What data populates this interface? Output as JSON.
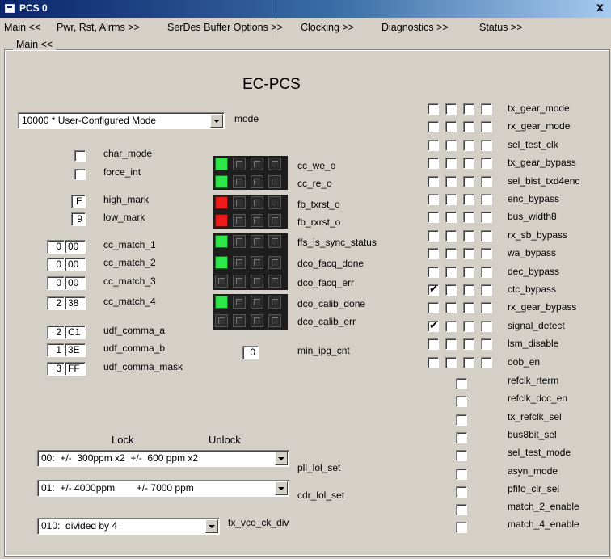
{
  "window": {
    "title": "PCS 0",
    "close_label": "x"
  },
  "menu": [
    "Main <<",
    "Pwr, Rst, Alrms >>",
    "SerDes Buffer Options >>",
    "Clocking >>",
    "Diagnostics >>",
    "Status >>"
  ],
  "group_label": "Main  <<",
  "heading": "EC-PCS",
  "mode": {
    "value": "10000 * User-Configured Mode",
    "label": "mode"
  },
  "char_mode": {
    "label": "char_mode",
    "checked": false
  },
  "force_int": {
    "label": "force_int",
    "checked": false
  },
  "high_mark": {
    "value": "E",
    "label": "high_mark"
  },
  "low_mark": {
    "value": "9",
    "label": "low_mark"
  },
  "cc_match": [
    {
      "a": "0",
      "b": "00",
      "label": "cc_match_1"
    },
    {
      "a": "0",
      "b": "00",
      "label": "cc_match_2"
    },
    {
      "a": "0",
      "b": "00",
      "label": "cc_match_3"
    },
    {
      "a": "2",
      "b": "38",
      "label": "cc_match_4"
    }
  ],
  "udf": [
    {
      "a": "2",
      "b": "C1",
      "label": "udf_comma_a"
    },
    {
      "a": "1",
      "b": "3E",
      "label": "udf_comma_b"
    },
    {
      "a": "3",
      "b": "FF",
      "label": "udf_comma_mask"
    }
  ],
  "status": [
    {
      "label": "cc_we_o",
      "leds": [
        "green",
        "grey",
        "grey",
        "grey"
      ]
    },
    {
      "label": "cc_re_o",
      "leds": [
        "green",
        "grey",
        "grey",
        "grey"
      ]
    },
    {
      "label": "fb_txrst_o",
      "leds": [
        "red",
        "grey",
        "grey",
        "grey"
      ]
    },
    {
      "label": "fb_rxrst_o",
      "leds": [
        "red",
        "grey",
        "grey",
        "grey"
      ]
    },
    {
      "label": "ffs_ls_sync_status",
      "leds": [
        "green",
        "grey",
        "grey",
        "grey"
      ]
    },
    {
      "label": "dco_facq_done",
      "leds": [
        "green",
        "grey",
        "grey",
        "grey"
      ]
    },
    {
      "label": "dco_facq_err",
      "leds": [
        "grey",
        "grey",
        "grey",
        "grey"
      ]
    },
    {
      "label": "dco_calib_done",
      "leds": [
        "green",
        "grey",
        "grey",
        "grey"
      ]
    },
    {
      "label": "dco_calib_err",
      "leds": [
        "grey",
        "grey",
        "grey",
        "grey"
      ]
    }
  ],
  "min_ipg": {
    "value": "0",
    "label": "min_ipg_cnt"
  },
  "lol_headers": {
    "lock": "Lock",
    "unlock": "Unlock"
  },
  "pll_lol": {
    "value": "00:  +/-  300ppm x2  +/-  600 ppm x2",
    "label": "pll_lol_set"
  },
  "cdr_lol": {
    "value": "01:  +/- 4000ppm        +/- 7000 ppm",
    "label": "cdr_lol_set"
  },
  "tx_vco": {
    "value": "010:  divided by 4",
    "label": "tx_vco_ck_div"
  },
  "right_quad": [
    {
      "label": "tx_gear_mode",
      "checks": [
        false,
        false,
        false,
        false
      ]
    },
    {
      "label": "rx_gear_mode",
      "checks": [
        false,
        false,
        false,
        false
      ]
    },
    {
      "label": "sel_test_clk",
      "checks": [
        false,
        false,
        false,
        false
      ]
    },
    {
      "label": "tx_gear_bypass",
      "checks": [
        false,
        false,
        false,
        false
      ]
    },
    {
      "label": "sel_bist_txd4enc",
      "checks": [
        false,
        false,
        false,
        false
      ]
    },
    {
      "label": "enc_bypass",
      "checks": [
        false,
        false,
        false,
        false
      ]
    },
    {
      "label": "bus_width8",
      "checks": [
        false,
        false,
        false,
        false
      ]
    },
    {
      "label": "rx_sb_bypass",
      "checks": [
        false,
        false,
        false,
        false
      ]
    },
    {
      "label": "wa_bypass",
      "checks": [
        false,
        false,
        false,
        false
      ]
    },
    {
      "label": "dec_bypass",
      "checks": [
        false,
        false,
        false,
        false
      ]
    },
    {
      "label": "ctc_bypass",
      "checks": [
        true,
        false,
        false,
        false
      ]
    },
    {
      "label": "rx_gear_bypass",
      "checks": [
        false,
        false,
        false,
        false
      ]
    },
    {
      "label": "signal_detect",
      "checks": [
        true,
        false,
        false,
        false
      ]
    },
    {
      "label": "lsm_disable",
      "checks": [
        false,
        false,
        false,
        false
      ]
    },
    {
      "label": "oob_en",
      "checks": [
        false,
        false,
        false,
        false
      ]
    }
  ],
  "right_single": [
    {
      "label": "refclk_rterm",
      "checked": false
    },
    {
      "label": "refclk_dcc_en",
      "checked": false
    },
    {
      "label": "tx_refclk_sel",
      "checked": false
    },
    {
      "label": "bus8bit_sel",
      "checked": false
    },
    {
      "label": "sel_test_mode",
      "checked": false
    },
    {
      "label": "asyn_mode",
      "checked": false
    },
    {
      "label": "pfifo_clr_sel",
      "checked": false
    },
    {
      "label": "match_2_enable",
      "checked": false
    },
    {
      "label": "match_4_enable",
      "checked": false
    }
  ]
}
